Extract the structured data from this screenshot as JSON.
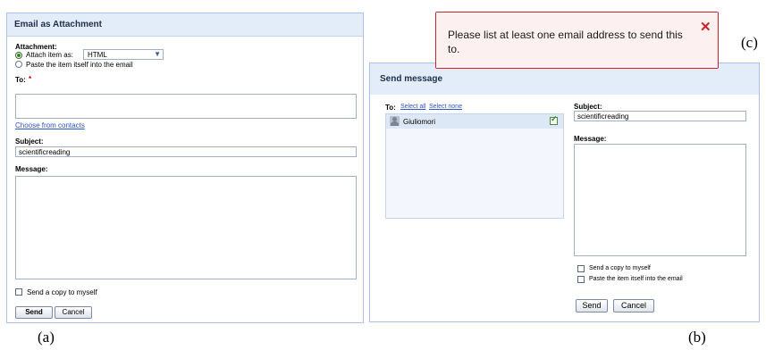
{
  "panel_a": {
    "title": "Email as Attachment",
    "attachment_label": "Attachment:",
    "attach_as_label": "Attach item as:",
    "attach_as_value": "HTML",
    "paste_label": "Paste the item itself into the email",
    "to_label": "To:",
    "required_mark": "*",
    "choose_contacts": "Choose from contacts",
    "subject_label": "Subject:",
    "subject_value": "scientificreading",
    "message_label": "Message:",
    "copy_label": "Send a copy to myself",
    "send_label": "Send",
    "cancel_label": "Cancel"
  },
  "panel_b": {
    "title": "Send message",
    "to_label": "To:",
    "select_all": "Select all",
    "select_none": "Select none",
    "contact_name": "Giuliomori",
    "subject_label": "Subject:",
    "subject_value": "scientificreading",
    "message_label": "Message:",
    "copy_label": "Send a copy to myself",
    "paste_label": "Paste the item itself into the email",
    "send_label": "Send",
    "cancel_label": "Cancel"
  },
  "tooltip": {
    "message": "Please list at least one email address to send this to.",
    "close_icon": "close-icon"
  },
  "captions": {
    "a": "(a)",
    "b": "(b)",
    "c": "(c)"
  },
  "colors": {
    "titlebar": "#e3ecf9",
    "border": "#a9c2e6",
    "link": "#2a55c8",
    "error_border": "#c9232b",
    "required": "#cc0000"
  }
}
